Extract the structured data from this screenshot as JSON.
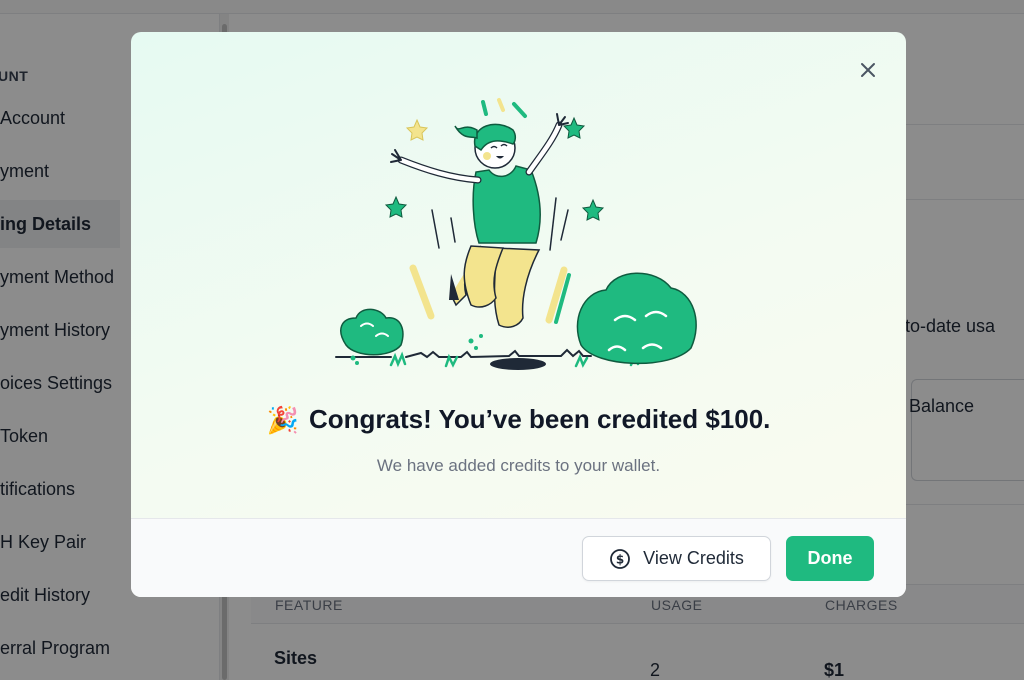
{
  "background": {
    "sidebar": {
      "heading": "UNT",
      "items": [
        {
          "label": "Account",
          "active": false
        },
        {
          "label": "yment",
          "active": false
        },
        {
          "label": "ing Details",
          "active": true
        },
        {
          "label": "yment Method",
          "active": false
        },
        {
          "label": "yment History",
          "active": false
        },
        {
          "label": "oices Settings",
          "active": false
        },
        {
          "label": "Token",
          "active": false
        },
        {
          "label": "tifications",
          "active": false
        },
        {
          "label": "H Key Pair",
          "active": false
        },
        {
          "label": "edit History",
          "active": false
        },
        {
          "label": "erral Program",
          "active": false
        }
      ]
    },
    "main": {
      "usage_text": "n-to-date usa",
      "credit_balance_label": "it Balance",
      "table": {
        "columns": [
          "FEATURE",
          "USAGE",
          "CHARGES"
        ],
        "rows": [
          {
            "feature": "Sites",
            "usage": "2",
            "charges": "$1"
          }
        ]
      }
    }
  },
  "modal": {
    "emoji": "🎉",
    "title": "Congrats! You’ve been credited $100.",
    "subtitle": "We have added credits to your wallet.",
    "buttons": {
      "view_credits": "View Credits",
      "done": "Done"
    },
    "colors": {
      "primary": "#1fba80",
      "illustration_green": "#1fba80",
      "illustration_yellow": "#f3e48e"
    },
    "icons": {
      "close": "close-icon",
      "view_credits": "dollar-circle-icon"
    }
  }
}
